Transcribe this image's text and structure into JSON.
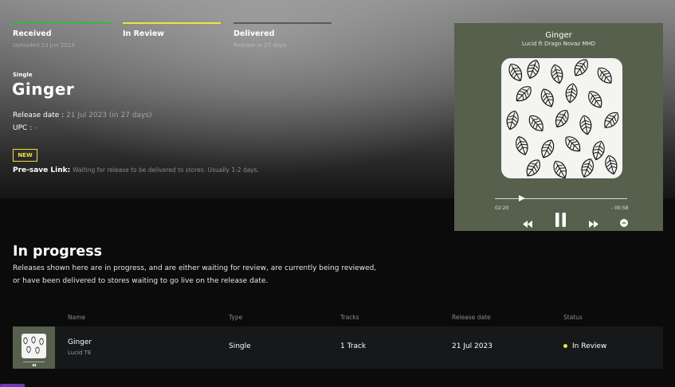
{
  "steps": [
    {
      "label": "Received",
      "sub": "Uploaded 23 Jun 2023",
      "color": "#3fb53c"
    },
    {
      "label": "In Review",
      "sub": "",
      "color": "#f2e33a"
    },
    {
      "label": "Delivered",
      "sub": "Release in 27 days",
      "color": "#5a5a5a"
    }
  ],
  "release": {
    "kind": "Single",
    "title": "Ginger",
    "release_date_label": "Release date :",
    "release_date_value": "21 Jul 2023",
    "release_date_rel": "(in 27 days)",
    "upc_label": "UPC :",
    "upc_value": "-",
    "new_badge": "NEW",
    "presave_label": "Pre-save Link:",
    "presave_text": "Waiting for release to be delivered to stores. Usually 1-2 days."
  },
  "player": {
    "title": "Ginger",
    "artist": "Lucid ft Drago Novaz MHD",
    "elapsed": "02:20",
    "remaining": "- 00:58",
    "progress": 0.18,
    "bg_color": "#56604d",
    "icons": [
      "rewind-icon",
      "pause-icon",
      "fast-forward-icon",
      "minus-circle-icon"
    ]
  },
  "in_progress": {
    "title": "In progress",
    "desc_line1": "Releases shown here are in progress, and are either waiting for review, are currently being reviewed,",
    "desc_line2": "or have been delivered to stores waiting to go live on the release date.",
    "columns": [
      "Name",
      "Type",
      "Tracks",
      "Release date",
      "Status"
    ],
    "rows": [
      {
        "name": "Ginger",
        "artist": "Lucid TE",
        "type": "Single",
        "tracks": "1 Track",
        "release_date": "21 Jul 2023",
        "status": "In Review",
        "status_color": "#f2e33a"
      }
    ]
  }
}
